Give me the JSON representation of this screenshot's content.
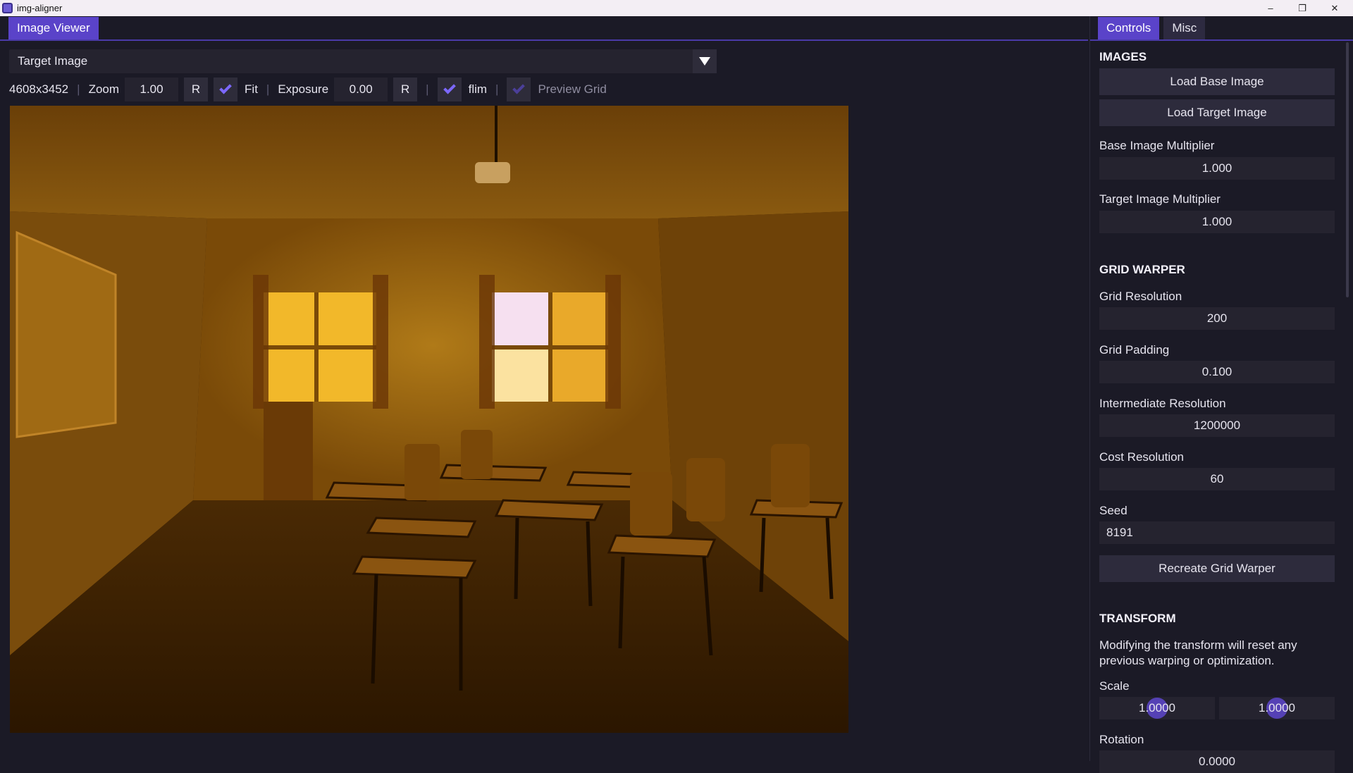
{
  "window": {
    "title": "img-aligner",
    "minimize": "–",
    "restore": "❐",
    "close": "✕"
  },
  "left_tabs": [
    {
      "label": "Image Viewer",
      "active": true
    }
  ],
  "right_tabs": [
    {
      "label": "Controls",
      "active": true
    },
    {
      "label": "Misc",
      "active": false
    }
  ],
  "viewer": {
    "image_select": "Target Image",
    "dimensions": "4608x3452",
    "zoom_label": "Zoom",
    "zoom_value": "1.00",
    "reset_label": "R",
    "fit_label": "Fit",
    "exposure_label": "Exposure",
    "exposure_value": "0.00",
    "flim_label": "flim",
    "preview_grid_label": "Preview Grid",
    "separator": "|"
  },
  "controls": {
    "images_heading": "IMAGES",
    "load_base": "Load Base Image",
    "load_target": "Load Target Image",
    "base_mult_label": "Base Image Multiplier",
    "base_mult_value": "1.000",
    "target_mult_label": "Target Image Multiplier",
    "target_mult_value": "1.000",
    "grid_heading": "GRID WARPER",
    "grid_res_label": "Grid Resolution",
    "grid_res_value": "200",
    "grid_pad_label": "Grid Padding",
    "grid_pad_value": "0.100",
    "inter_res_label": "Intermediate Resolution",
    "inter_res_value": "1200000",
    "cost_res_label": "Cost Resolution",
    "cost_res_value": "60",
    "seed_label": "Seed",
    "seed_value": "8191",
    "recreate_button": "Recreate Grid Warper",
    "transform_heading": "TRANSFORM",
    "transform_note": "Modifying the transform will reset any previous warping or optimization.",
    "scale_label": "Scale",
    "scale_x": "1.0000",
    "scale_y": "1.0000",
    "rotation_label": "Rotation",
    "rotation_value": "0.0000"
  },
  "colors": {
    "accent": "#5a43c9",
    "check": "#7c68ff",
    "background": "#1b1a26"
  }
}
